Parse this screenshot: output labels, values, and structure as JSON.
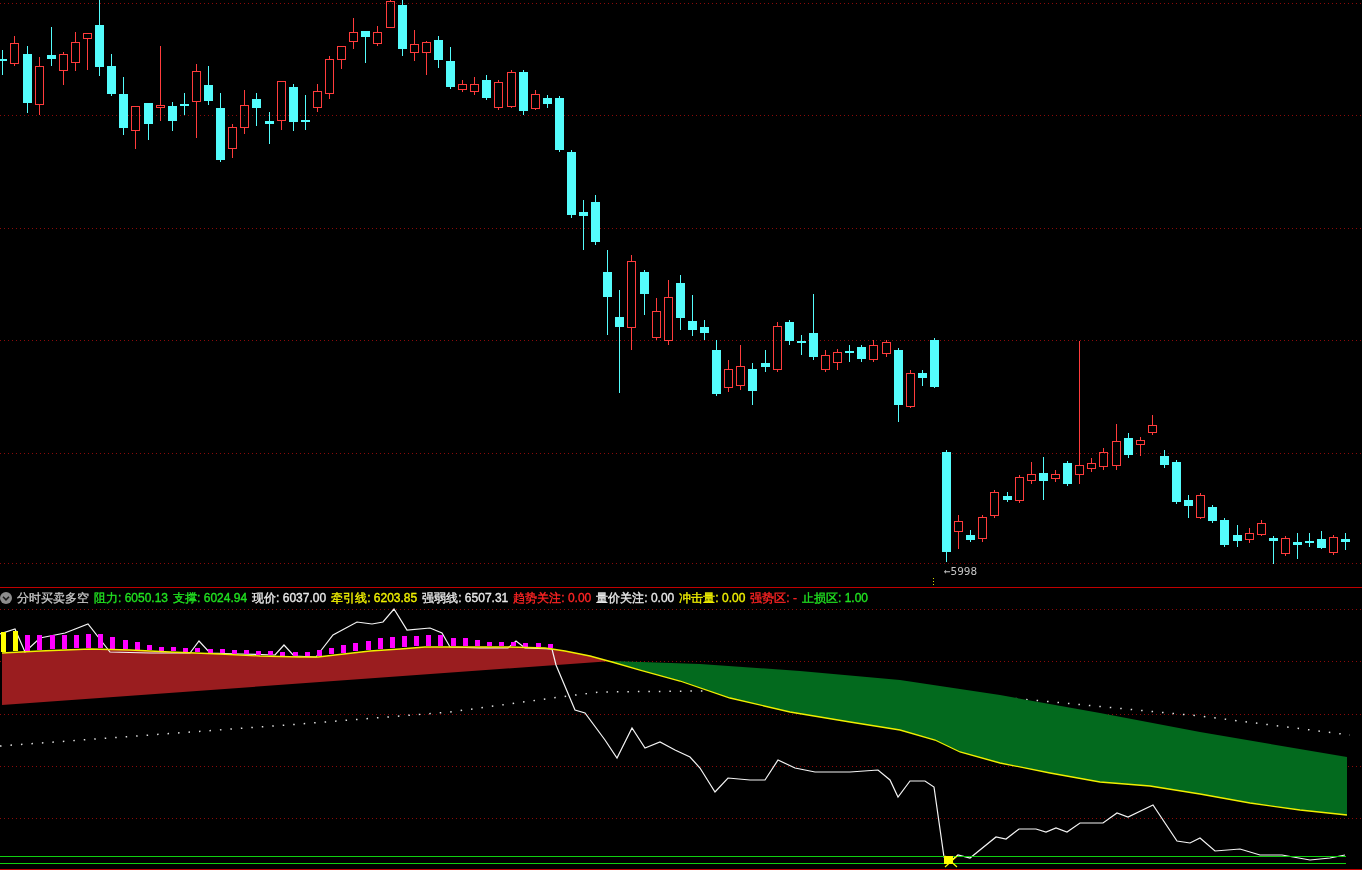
{
  "price_chart": {
    "low_label": "←5998"
  },
  "indicator": {
    "name": "分时买卖多空",
    "readouts": [
      {
        "text": "阻力: 6050.13",
        "color": "#20e020"
      },
      {
        "text": "支撑: 6024.94",
        "color": "#20e020"
      },
      {
        "text": "现价: 6037.00",
        "color": "#e8e8e8"
      },
      {
        "text": "牵引线: 6203.85",
        "color": "#f0f000"
      },
      {
        "text": "强弱线: 6507.31",
        "color": "#e8e8e8"
      },
      {
        "text": "趋势关注: 0.00",
        "color": "#ff2424"
      },
      {
        "text": "量价关注: 0.00",
        "color": "#e8e8e8"
      },
      {
        "text": "冲击量: 0.00",
        "color": "#f0f000"
      },
      {
        "text": "强势区: -",
        "color": "#ff2424"
      },
      {
        "text": "止损区: 1.00",
        "color": "#20e020"
      }
    ]
  }
}
